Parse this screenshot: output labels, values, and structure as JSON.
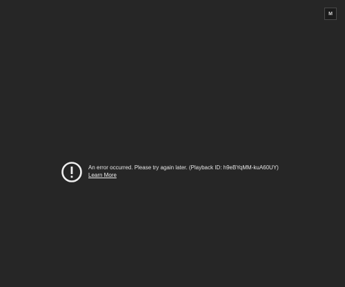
{
  "player": {
    "corner_button_label": "M"
  },
  "error": {
    "icon": "exclamation-circle-icon",
    "message": "An error occurred. Please try again later. (Playback ID: h9eBYqMM-kuA60UY)",
    "learn_more_label": "Learn More"
  },
  "colors": {
    "background": "#262626",
    "text": "#e6e6e6"
  }
}
